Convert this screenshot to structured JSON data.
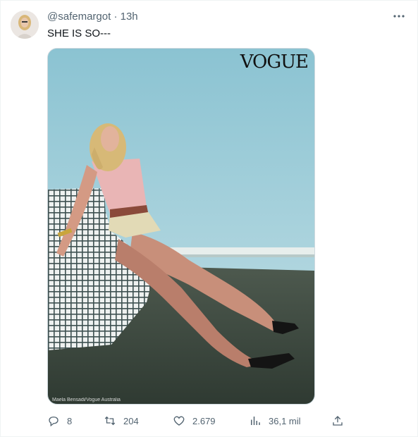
{
  "tweet": {
    "handle": "@safemargot",
    "time": "· 13h",
    "text": "SHE IS SO---",
    "more_icon": "more-horizontal-icon"
  },
  "media": {
    "magazine_logo": "VOGUE",
    "photo_credit": "Maela Bensadi/Vogue Australia"
  },
  "actions": {
    "reply": {
      "icon": "reply-icon",
      "count": "8"
    },
    "retweet": {
      "icon": "retweet-icon",
      "count": "204"
    },
    "like": {
      "icon": "heart-icon",
      "count": "2.679"
    },
    "views": {
      "icon": "views-icon",
      "count": "36,1 mil"
    },
    "share": {
      "icon": "share-icon"
    }
  },
  "colors": {
    "secondary_text": "#536471",
    "primary_text": "#0f1419",
    "border": "#cfd9de"
  }
}
